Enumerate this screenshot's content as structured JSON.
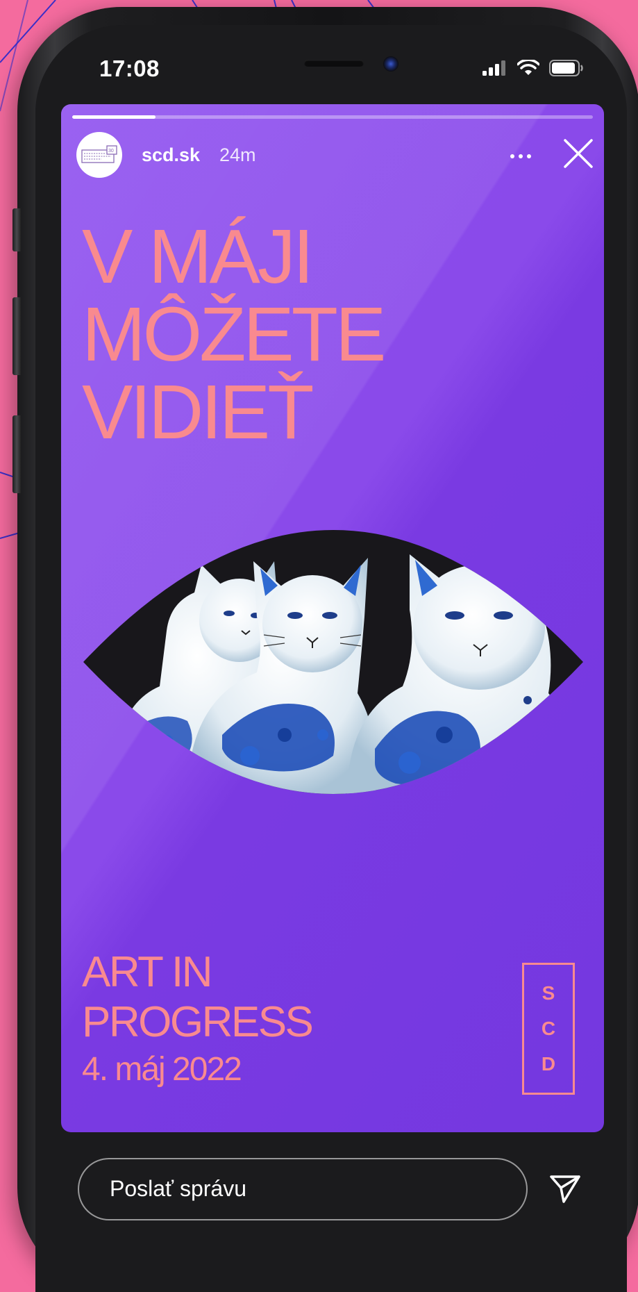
{
  "status_bar": {
    "time": "17:08"
  },
  "story": {
    "username": "scd.sk",
    "time_ago": "24m",
    "progress": 0.16,
    "headline": [
      "V MÁJI",
      "MÔŽETE",
      "VIDIEŤ"
    ],
    "footer_title": [
      "ART IN",
      "PROGRESS"
    ],
    "date": "4. máj 2022",
    "badge_letters": [
      "S",
      "C",
      "D"
    ],
    "colors": {
      "background": "#8a48eb",
      "accent_text": "#f98a8f",
      "page_background": "#f46b9e"
    }
  },
  "composer": {
    "placeholder": "Poslať správu"
  },
  "icons": {
    "avatar": "scd-logo-icon",
    "more": "more-dots-icon",
    "close": "close-icon",
    "send": "send-icon",
    "signal": "signal-icon",
    "wifi": "wifi-icon",
    "battery": "battery-icon"
  }
}
